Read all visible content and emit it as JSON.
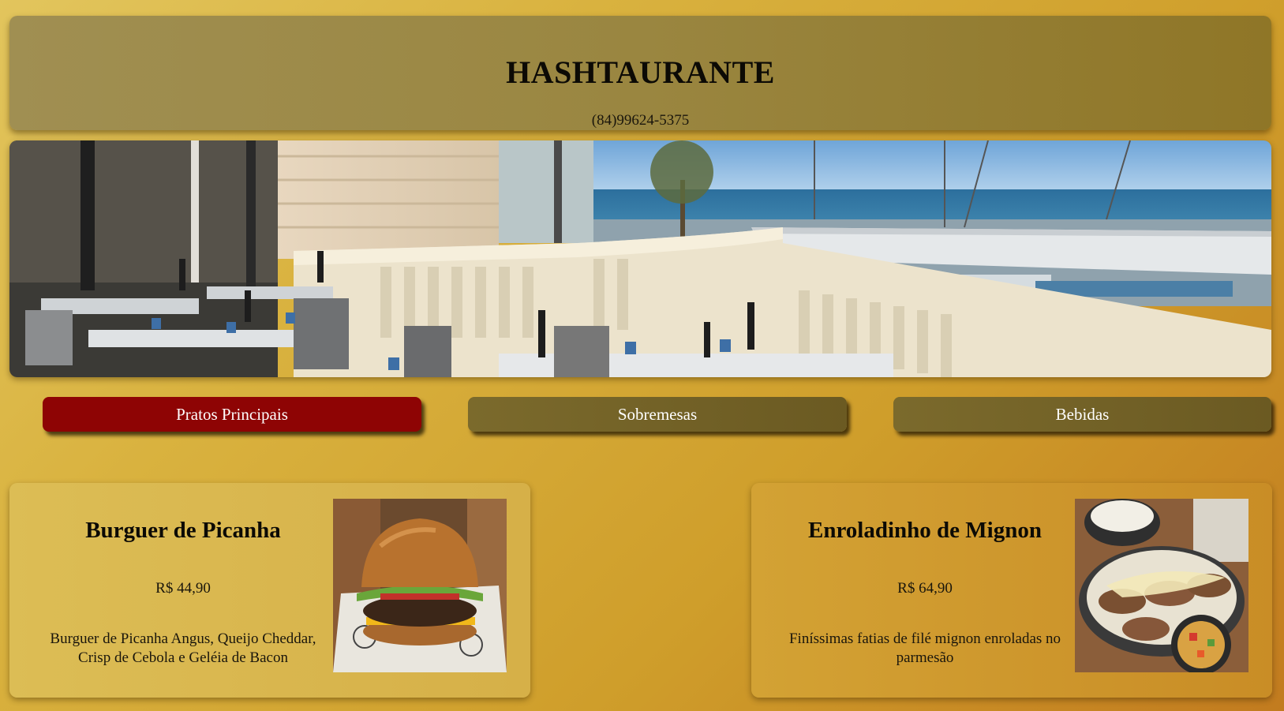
{
  "header": {
    "title": "HASHTAURANTE",
    "phone": "(84)99624-5375"
  },
  "hero": {
    "image": "restaurant-terrace-marina-photo"
  },
  "tabs": [
    {
      "label": "Pratos Principais",
      "active": true
    },
    {
      "label": "Sobremesas",
      "active": false
    },
    {
      "label": "Bebidas",
      "active": false
    }
  ],
  "colors": {
    "active_tab": "#8e0404",
    "inactive_tab": "#7b6a2c",
    "header_bg": "#9a8640",
    "page_bg": "#d9b23f"
  },
  "menu": [
    {
      "name": "Burguer de Picanha",
      "price": "R$ 44,90",
      "description": "Burguer de Picanha Angus, Queijo Cheddar, Crisp de Cebola e Geléia de Bacon",
      "image": "burger-photo"
    },
    {
      "name": "Enroladinho de Mignon",
      "price": "R$ 64,90",
      "description": "Finíssimas fatias de filé mignon enroladas no parmesão",
      "image": "mignon-rolls-photo"
    }
  ]
}
